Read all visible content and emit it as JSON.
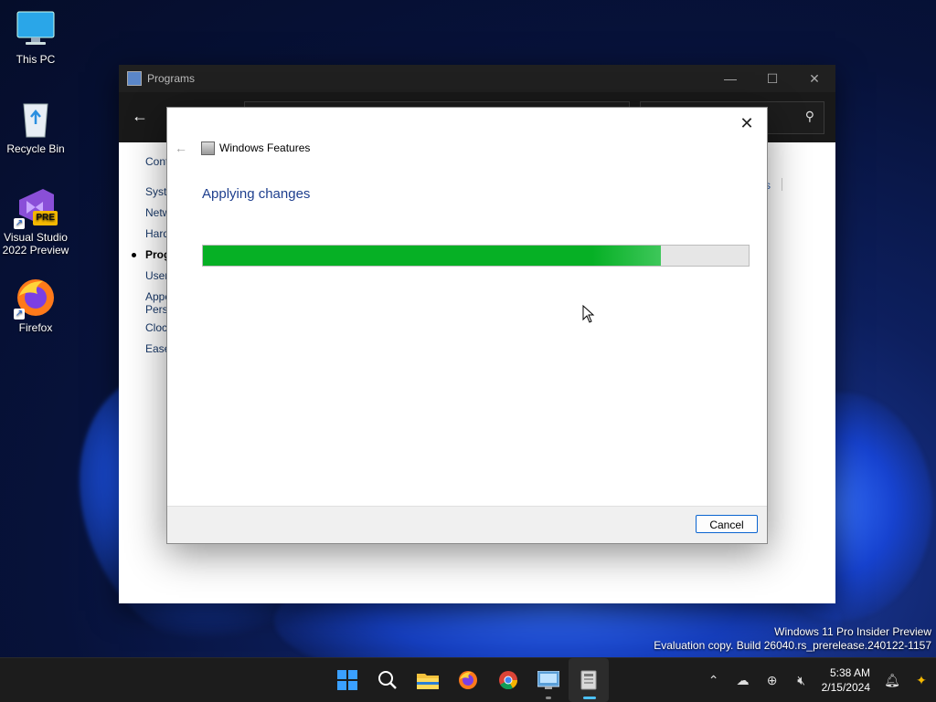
{
  "desktop": {
    "icons": [
      {
        "label": "This PC"
      },
      {
        "label": "Recycle Bin"
      },
      {
        "label": "Visual Studio 2022 Preview",
        "badge": "PRE"
      },
      {
        "label": "Firefox"
      }
    ]
  },
  "programs_window": {
    "title": "Programs",
    "sidebar": [
      "Cont",
      "Syste",
      "Netw",
      "Hard",
      "Prog",
      "User",
      "Appe",
      "Perso",
      "Clock",
      "Ease"
    ],
    "right_link": "s"
  },
  "dialog": {
    "title": "Windows Features",
    "heading": "Applying changes",
    "progress_percent": 84,
    "cancel_label": "Cancel"
  },
  "watermark": {
    "line1": "Windows 11 Pro Insider Preview",
    "line2": "Evaluation copy. Build 26040.rs_prerelease.240122-1157"
  },
  "taskbar": {
    "apps": [
      "start-icon",
      "search-icon",
      "file-explorer-icon",
      "firefox-icon",
      "chrome-icon",
      "control-panel-icon",
      "windows-features-icon"
    ],
    "time": "5:38 AM",
    "date": "2/15/2024"
  },
  "colors": {
    "progress": "#06b025",
    "heading": "#1e3f8e",
    "accent": "#0a64d0"
  }
}
